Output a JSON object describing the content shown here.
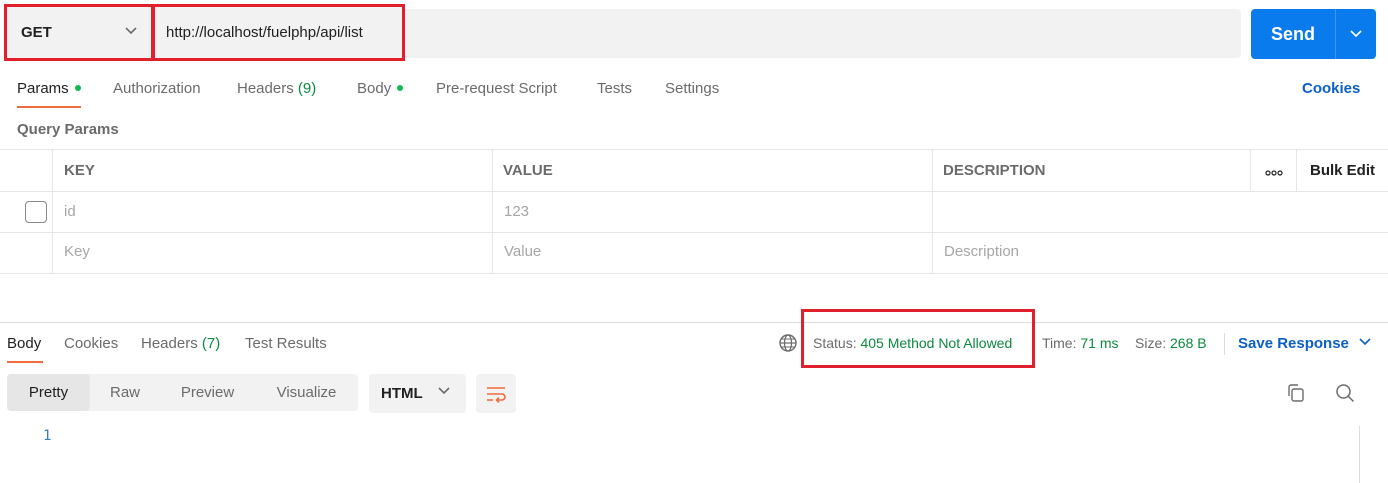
{
  "request": {
    "method": "GET",
    "url": "http://localhost/fuelphp/api/list",
    "send_label": "Send"
  },
  "request_tabs": [
    {
      "label": "Params",
      "dot": true
    },
    {
      "label": "Authorization"
    },
    {
      "label": "Headers",
      "count": "(9)"
    },
    {
      "label": "Body",
      "dot": true
    },
    {
      "label": "Pre-request Script"
    },
    {
      "label": "Tests"
    },
    {
      "label": "Settings"
    }
  ],
  "cookies_link": "Cookies",
  "query_params": {
    "title": "Query Params",
    "headers": {
      "key": "KEY",
      "value": "VALUE",
      "description": "DESCRIPTION",
      "bulk_edit": "Bulk Edit"
    },
    "rows": [
      {
        "key": "id",
        "value": "123",
        "description": ""
      }
    ],
    "placeholders": {
      "key": "Key",
      "value": "Value",
      "description": "Description"
    }
  },
  "response": {
    "tabs": [
      {
        "label": "Body"
      },
      {
        "label": "Cookies"
      },
      {
        "label": "Headers",
        "count": "(7)"
      },
      {
        "label": "Test Results"
      }
    ],
    "status_label": "Status:",
    "status_value": "405 Method Not Allowed",
    "time_label": "Time:",
    "time_value": "71 ms",
    "size_label": "Size:",
    "size_value": "268 B",
    "save_response": "Save Response",
    "view_modes": [
      "Pretty",
      "Raw",
      "Preview",
      "Visualize"
    ],
    "active_view": "Pretty",
    "format": "HTML",
    "line_numbers": [
      "1"
    ]
  },
  "colors": {
    "accent": "#097bed",
    "highlight_box": "#e0202a",
    "success": "#0c8a3e",
    "tab_underline": "#f26b3a"
  }
}
